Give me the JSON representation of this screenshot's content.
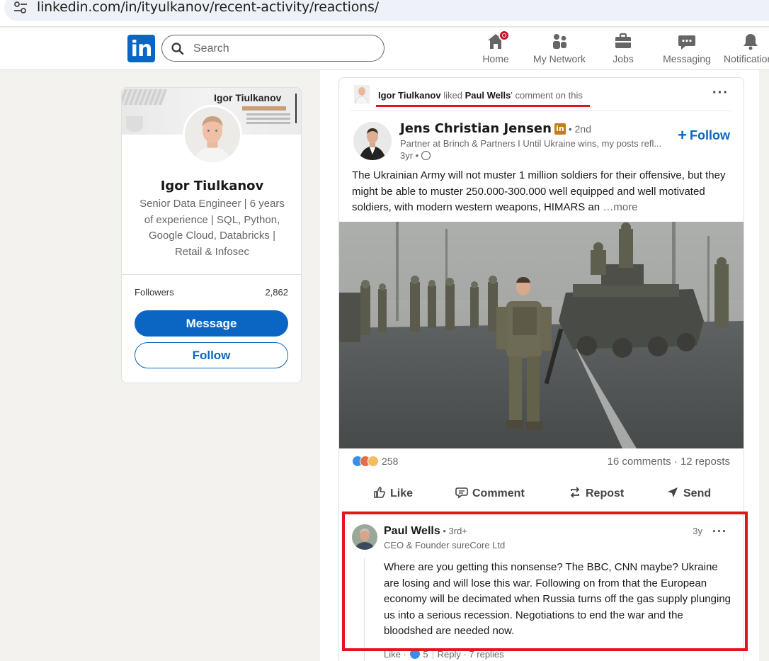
{
  "browser": {
    "url": "linkedin.com/in/ityulkanov/recent-activity/reactions/"
  },
  "nav": {
    "logo": "in",
    "search_placeholder": "Search",
    "items": [
      {
        "label": "Home",
        "icon": "home-icon"
      },
      {
        "label": "My Network",
        "icon": "network-icon"
      },
      {
        "label": "Jobs",
        "icon": "briefcase-icon"
      },
      {
        "label": "Messaging",
        "icon": "messaging-icon"
      },
      {
        "label": "Notifications",
        "icon": "bell-icon"
      }
    ]
  },
  "profile": {
    "banner_name": "Igor Tiulkanov",
    "name": "Igor Tiulkanov",
    "headline": "Senior Data Engineer | 6 years of experience | SQL, Python, Google Cloud, Databricks | Retail & Infosec",
    "followers_label": "Followers",
    "followers_count": "2,862",
    "message_label": "Message",
    "follow_label": "Follow"
  },
  "activity": {
    "actor": "Igor Tiulkanov",
    "verb": " liked ",
    "target": "Paul Wells",
    "suffix": "' comment on this",
    "more": "···"
  },
  "post": {
    "author": "Jens Christian Jensen",
    "premium_badge": "in",
    "degree": " • 2nd",
    "subtitle": "Partner at Brinch & Partners I Until Ukraine wins, my posts refl...",
    "time": "3yr • ",
    "follow_label": "Follow",
    "text": "The Ukrainian Army will not muster 1 million soldiers for their offensive, but they might be able to muster 250.000-300.000 well equipped and well motivated soldiers, with modern western weapons, HIMARS an",
    "more_label": "  …more",
    "reaction_count": "258",
    "stats": "16 comments · 12 reposts",
    "actions": [
      "Like",
      "Comment",
      "Repost",
      "Send"
    ]
  },
  "comment": {
    "author": "Paul Wells",
    "degree": " • 3rd+",
    "subtitle": "CEO & Founder sureCore Ltd",
    "time": "3y",
    "more": "···",
    "text": "Where are you getting this nonsense? The BBC, CNN maybe? Ukraine are losing and will lose this war. Following on from that the European economy will be decimated when Russia turns off the gas supply plunging us into a serious recession. Negotiations to end the war and the bloodshed are needed now.",
    "like_label": "Like · ",
    "like_count": "5",
    "reply_label": "Reply · 7 replies"
  },
  "colors": {
    "brand": "#0a66c2",
    "highlight": "#e3141c",
    "notification": "#cb112d"
  }
}
